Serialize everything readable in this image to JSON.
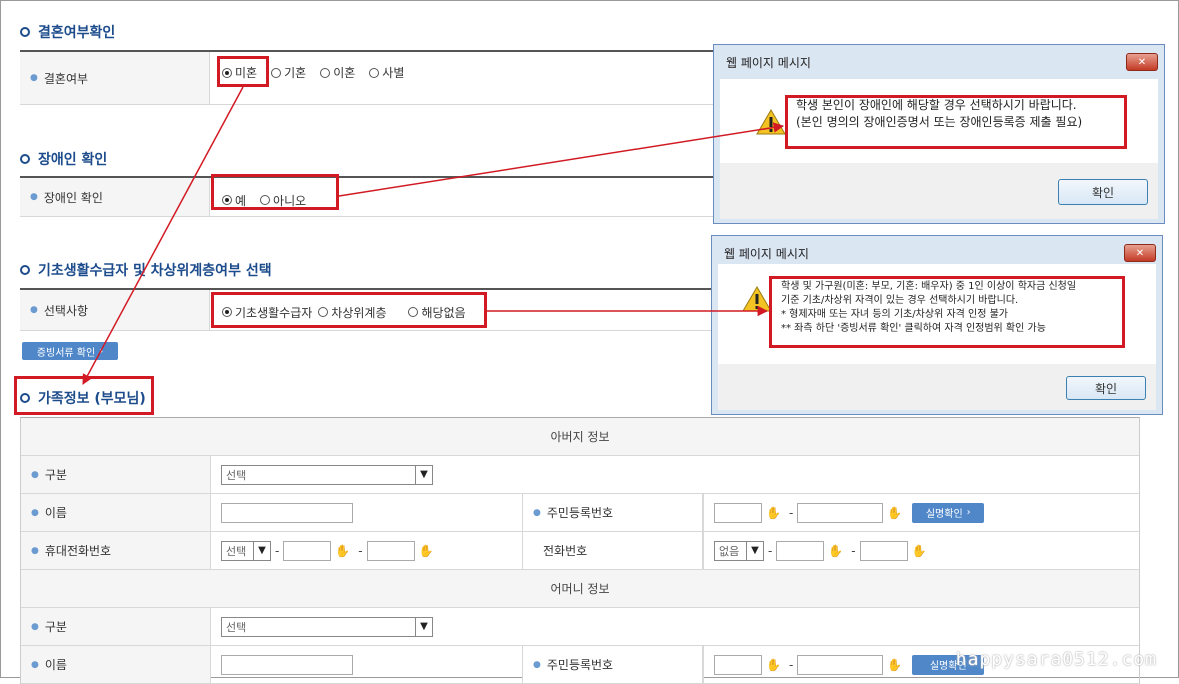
{
  "sections": {
    "marriage": {
      "title": "결혼여부확인",
      "label": "결혼여부",
      "options": [
        "미혼",
        "기혼",
        "이혼",
        "사별"
      ]
    },
    "disability": {
      "title": "장애인 확인",
      "label": "장애인 확인",
      "options": [
        "예",
        "아니오"
      ]
    },
    "basic": {
      "title": "기초생활수급자 및 차상위계층여부 선택",
      "label": "선택사항",
      "options": [
        "기초생활수급자",
        "차상위계층",
        "해당없음"
      ]
    }
  },
  "proof_button": "증빙서류 확인",
  "family": {
    "title": "가족정보 (부모님)",
    "father_header": "아버지 정보",
    "mother_header": "어머니 정보",
    "labels": {
      "type": "구분",
      "name": "이름",
      "rrn": "주민등록번호",
      "mobile": "휴대전화번호",
      "phone": "전화번호"
    },
    "select_placeholder": "선택",
    "mobile_select": "선택",
    "phone_select": "없음",
    "verify_button": "실명확인"
  },
  "dialog1": {
    "title": "웹 페이지 메시지",
    "lines": [
      "학생 본인이 장애인에 해당할 경우 선택하시기 바랍니다.",
      "(본인 명의의 장애인증명서 또는 장애인등록증 제출 필요)"
    ],
    "ok": "확인"
  },
  "dialog2": {
    "title": "웹 페이지 메시지",
    "lines": [
      "학생 및 가구원(미혼: 부모, 기혼: 배우자) 중 1인 이상이 학자금 신청일",
      "기준 기초/차상위 자격이 있는 경우 선택하시기 바랍니다.",
      "* 형제자매 또는 자녀 등의 기초/차상위 자격 인정 불가",
      "** 좌측 하단 '증빙서류 확인' 클릭하여 자격 인정범위 확인 가능"
    ],
    "ok": "확인"
  },
  "watermark": "happysara0512.com",
  "colors": {
    "accent": "#1d4c8c",
    "highlight": "#d11a24",
    "button": "#4f87c9"
  }
}
